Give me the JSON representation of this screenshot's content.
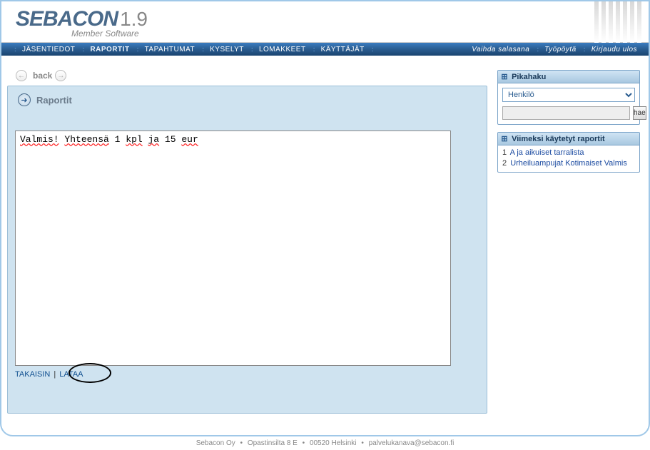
{
  "app": {
    "logo_main": "SEBACON",
    "logo_version": "1.9",
    "logo_sub": "Member Software"
  },
  "nav": {
    "items": [
      {
        "label": "JÄSENTIEDOT",
        "active": false
      },
      {
        "label": "RAPORTIT",
        "active": true
      },
      {
        "label": "TAPAHTUMAT",
        "active": false
      },
      {
        "label": "KYSELYT",
        "active": false
      },
      {
        "label": "LOMAKKEET",
        "active": false
      },
      {
        "label": "KÄYTTÄJÄT",
        "active": false
      }
    ],
    "right": [
      {
        "label": "Vaihda salasana"
      },
      {
        "label": "Työpöytä"
      },
      {
        "label": "Kirjaudu ulos"
      }
    ]
  },
  "back": {
    "label": "back"
  },
  "panel": {
    "title": "Raportit",
    "report_text": {
      "w1": "Valmis!",
      "w2": "Yhteensä",
      "w3": "1",
      "w4": "kpl",
      "w5": "ja",
      "w6": "15",
      "w7": "eur"
    },
    "actions": {
      "back": "TAKAISIN",
      "download": "LATAA"
    }
  },
  "sidebar": {
    "quicksearch": {
      "title": "Pikahaku",
      "select_value": "Henkilö",
      "button": "hae"
    },
    "recent": {
      "title": "Viimeksi käytetyt raportit",
      "items": [
        {
          "num": "1",
          "label": "A ja aikuiset tarralista"
        },
        {
          "num": "2",
          "label": "Urheiluampujat Kotimaiset Valmis"
        }
      ]
    }
  },
  "footer": {
    "p1": "Sebacon Oy",
    "p2": "Opastinsilta 8 E",
    "p3": "00520 Helsinki",
    "p4": "palvelukanava@sebacon.fi"
  }
}
